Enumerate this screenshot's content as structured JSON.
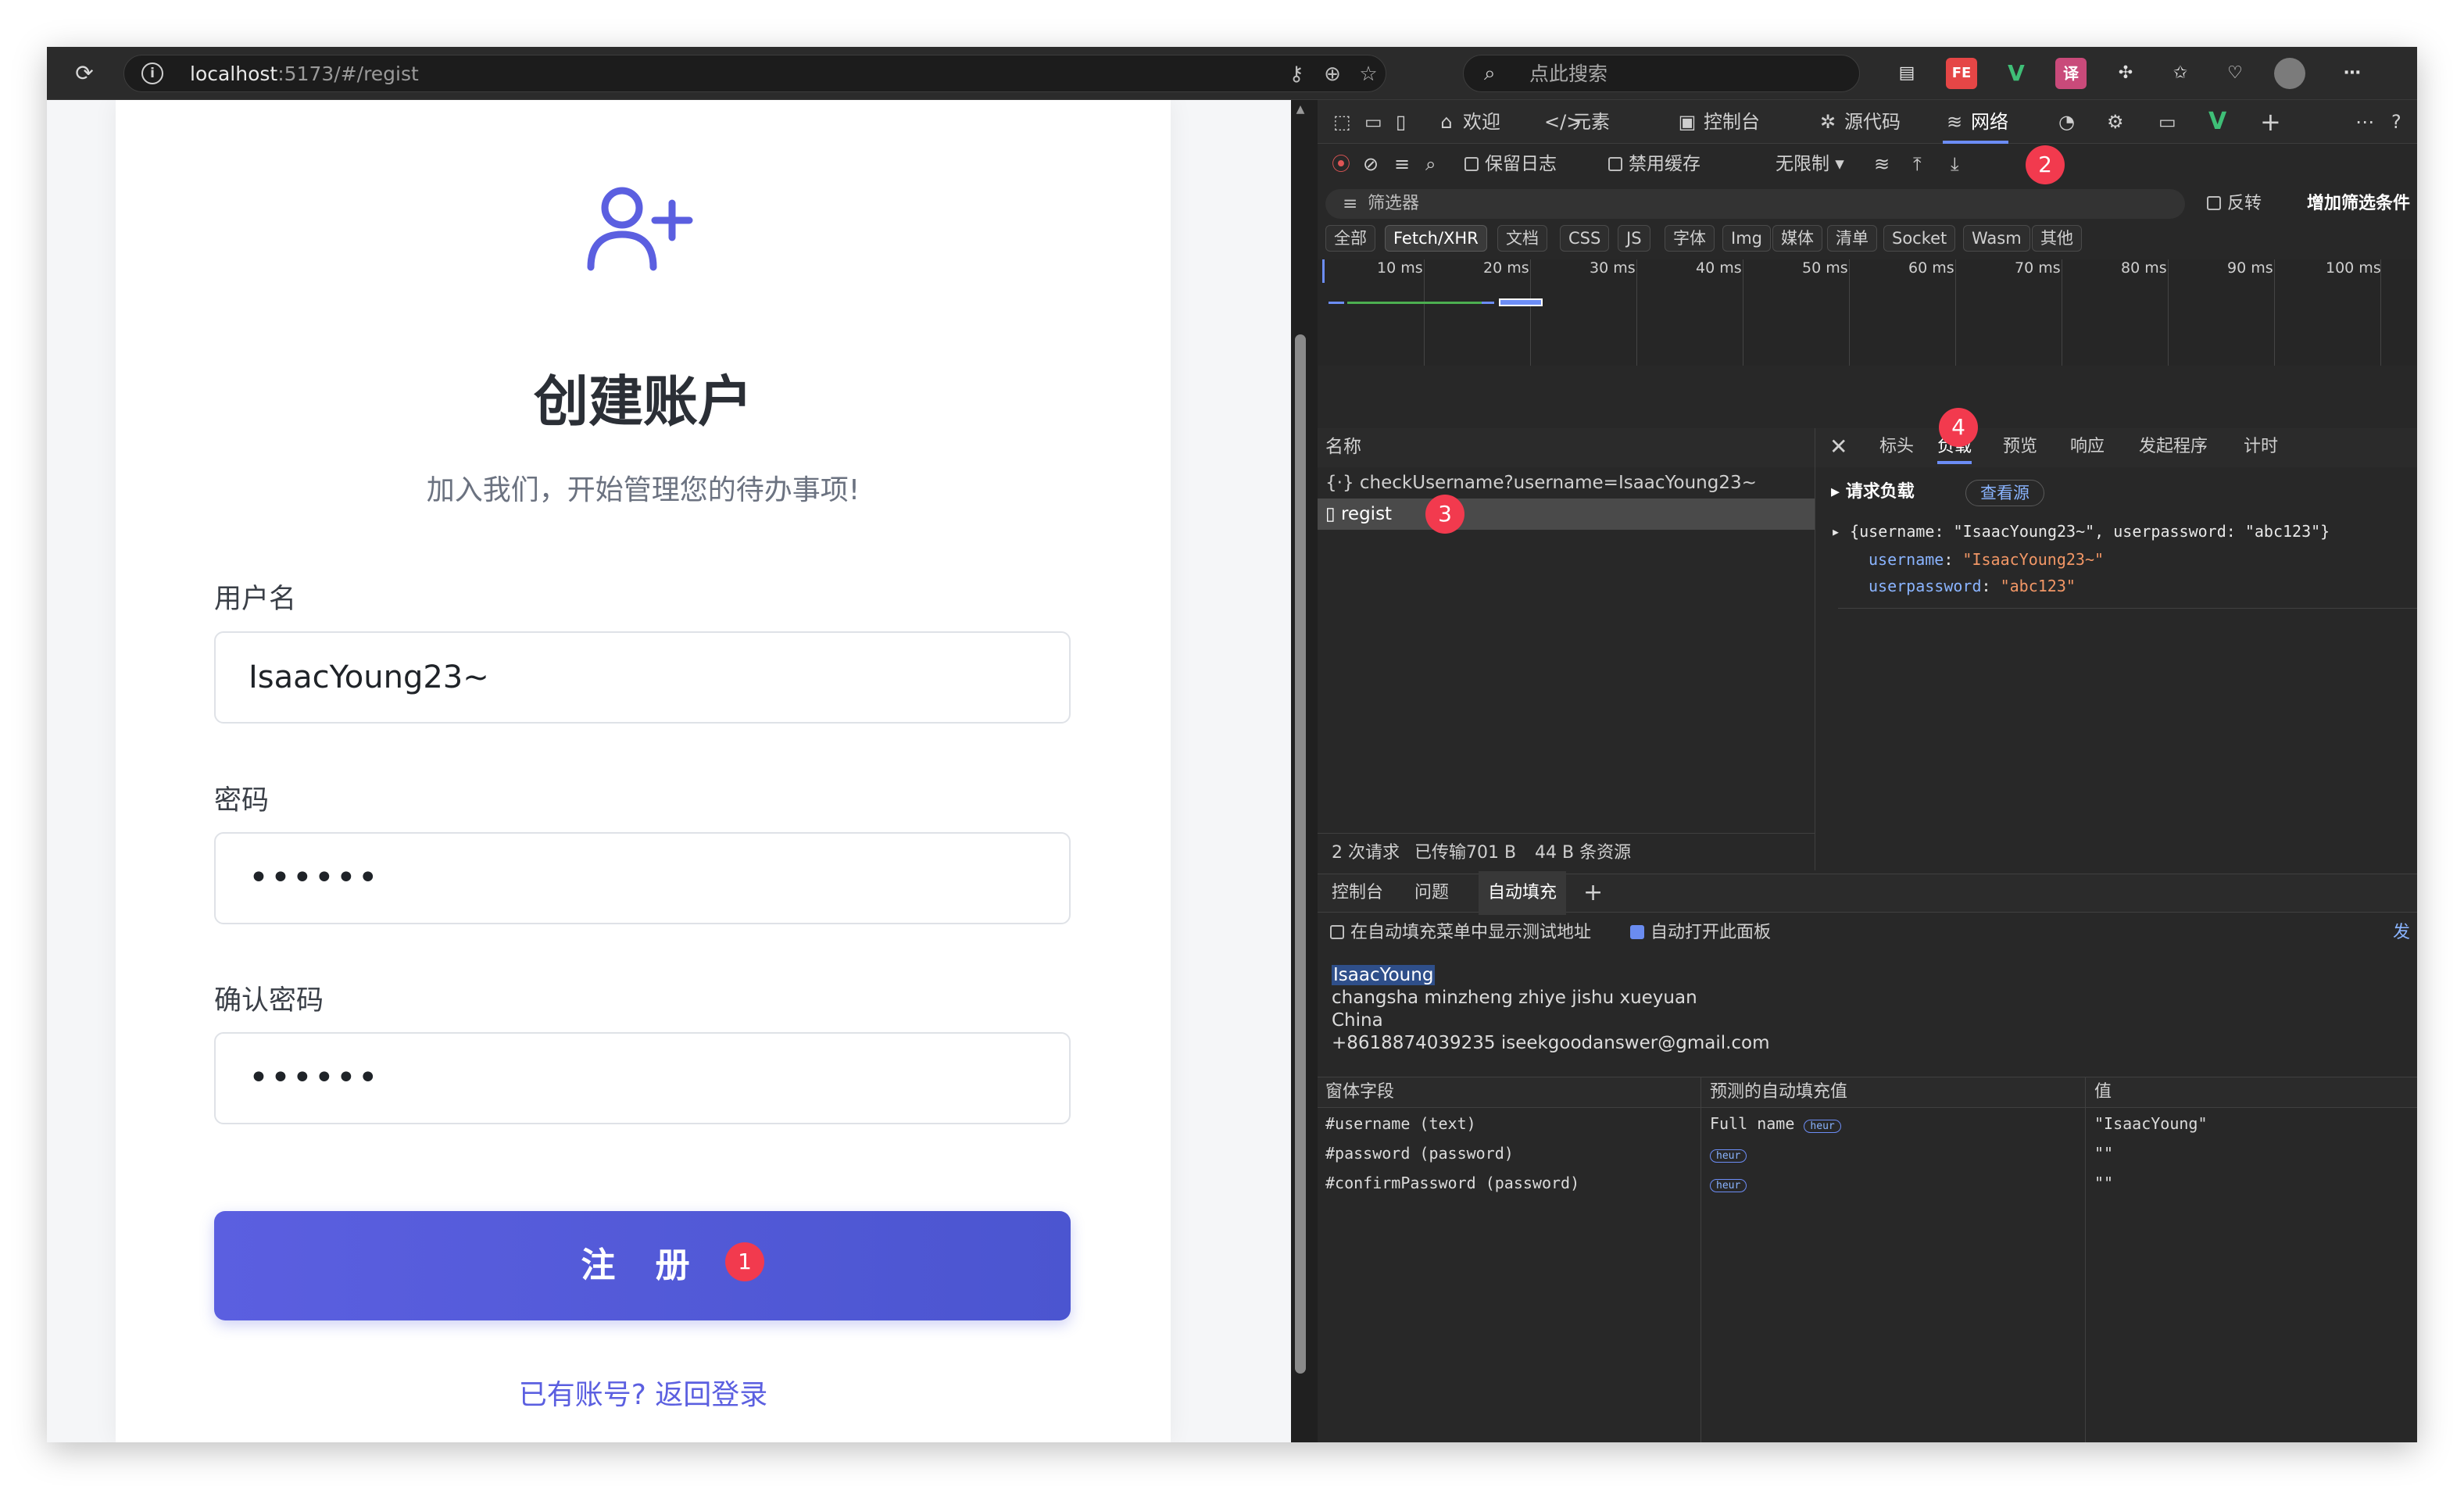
{
  "browser": {
    "url_host": "localhost",
    "url_rest": ":5173/#/regist",
    "search_placeholder": "点此搜索",
    "ext_fe": "FE",
    "ext_v": "V",
    "ext_translate": "译"
  },
  "page": {
    "title": "创建账户",
    "subtitle": "加入我们，开始管理您的待办事项!",
    "username_label": "用户名",
    "username_value": "IsaacYoung23~",
    "password_label": "密码",
    "password_value": "••••••",
    "confirm_label": "确认密码",
    "confirm_value": "••••••",
    "register_button": "注 册",
    "login_link": "已有账号? 返回登录"
  },
  "badges": {
    "b1": "1",
    "b2": "2",
    "b3": "3",
    "b4": "4"
  },
  "devtools": {
    "tabs": [
      "欢迎",
      "元素",
      "控制台",
      "源代码",
      "网络"
    ],
    "network_bar": {
      "preserve_log": "保留日志",
      "disable_cache": "禁用缓存",
      "throttle": "无限制"
    },
    "filter_placeholder": "筛选器",
    "invert": "反转",
    "more_filters": "增加筛选条件",
    "types": [
      "全部",
      "Fetch/XHR",
      "文档",
      "CSS",
      "JS",
      "字体",
      "Img",
      "媒体",
      "清单",
      "Socket",
      "Wasm",
      "其他"
    ],
    "ticks": [
      "10 ms",
      "20 ms",
      "30 ms",
      "40 ms",
      "50 ms",
      "60 ms",
      "70 ms",
      "80 ms",
      "90 ms",
      "100 ms"
    ],
    "name_header": "名称",
    "requests": [
      "checkUsername?username=IsaacYoung23~",
      "regist"
    ],
    "detail_tabs": [
      "标头",
      "负载",
      "预览",
      "响应",
      "发起程序",
      "计时"
    ],
    "payload_title": "请求负载",
    "view_source": "查看源",
    "payload_summary": "{username: \"IsaacYoung23~\", userpassword: \"abc123\"}",
    "payload_fields": [
      {
        "key": "username",
        "value": "\"IsaacYoung23~\""
      },
      {
        "key": "userpassword",
        "value": "\"abc123\""
      }
    ],
    "status": {
      "requests": "2 次请求",
      "transferred": "已传输701 B",
      "resources": "44 B 条资源"
    },
    "drawer_tabs": [
      "控制台",
      "问题",
      "自动填充"
    ],
    "autofill_opts": {
      "show_test": "在自动填充菜单中显示测试地址",
      "auto_open": "自动打开此面板",
      "right": "发"
    },
    "address": [
      "IsaacYoung",
      "changsha minzheng zhiye jishu xueyuan",
      "China",
      "+8618874039235 iseekgoodanswer@gmail.com"
    ],
    "table_headers": [
      "窗体字段",
      "预测的自动填充值",
      "值"
    ],
    "table_rows": [
      {
        "field": "#username (text)",
        "predicted": "Full name",
        "tag": "heur",
        "value": "\"IsaacYoung\""
      },
      {
        "field": "#password (password)",
        "predicted": "",
        "tag": "heur",
        "value": "\"\""
      },
      {
        "field": "#confirmPassword (password)",
        "predicted": "",
        "tag": "heur",
        "value": "\"\""
      }
    ]
  },
  "colors": {
    "accent": "#5b5fe0",
    "badge": "#f23a4e",
    "highlight_box": "#e8303b",
    "devtools_bg": "#282828"
  }
}
